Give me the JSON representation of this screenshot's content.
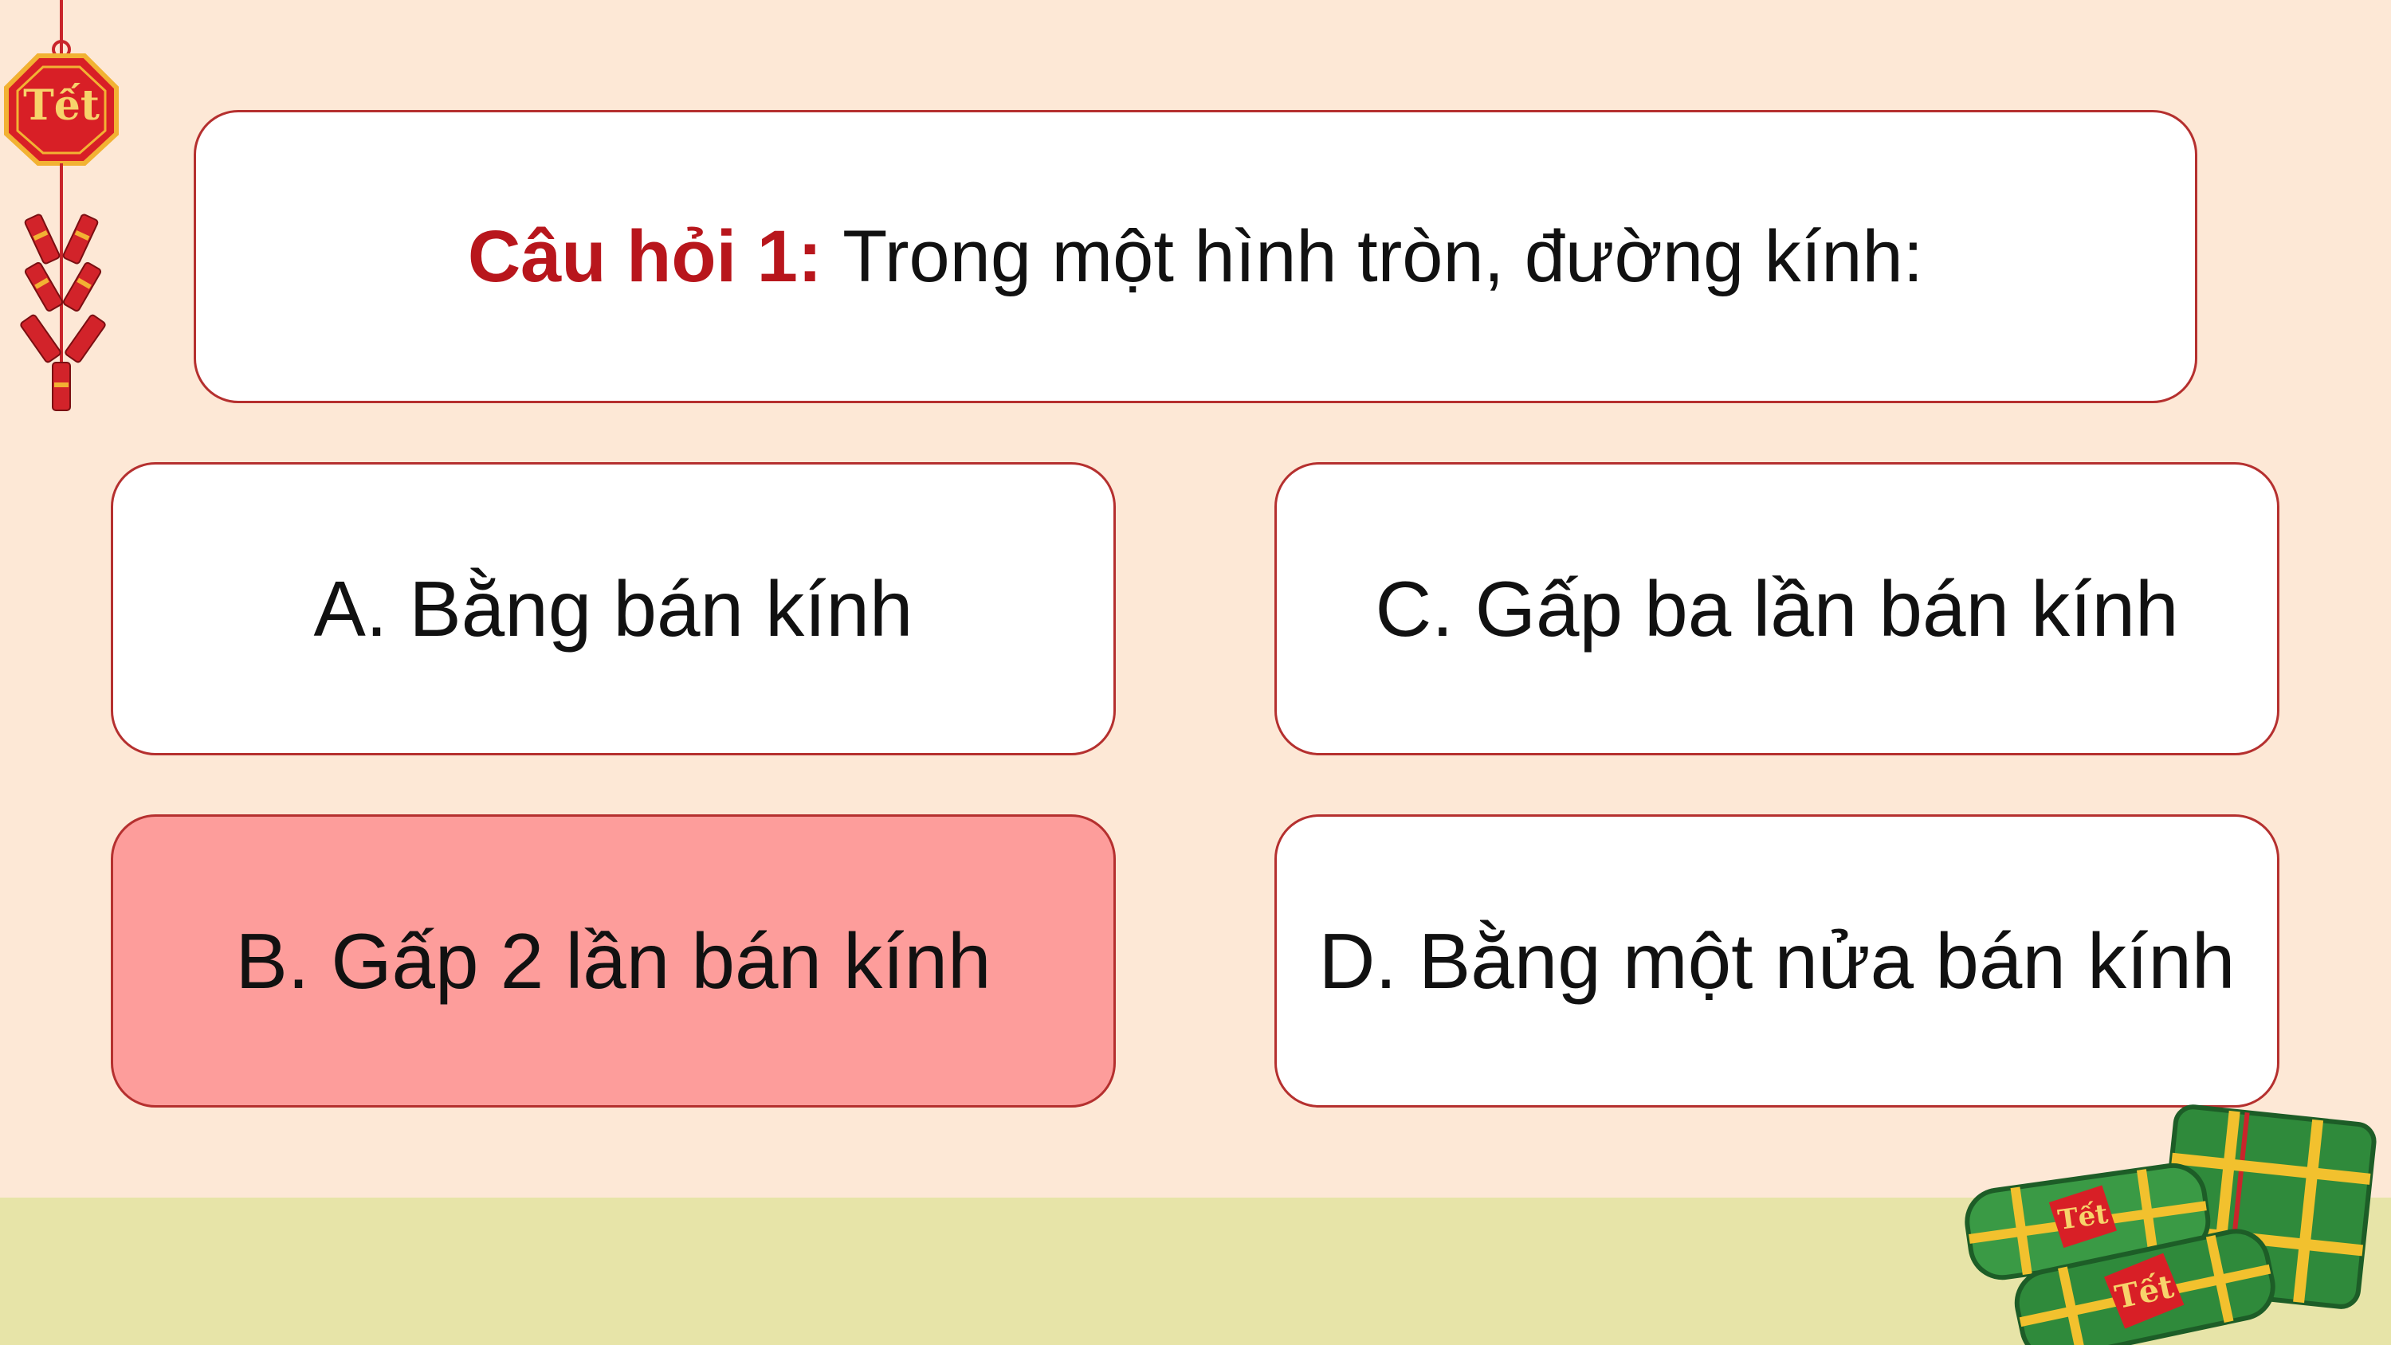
{
  "question": {
    "label": "Câu hỏi 1: ",
    "text": "Trong một hình tròn, đường kính:"
  },
  "answers": [
    {
      "text": "A. Bằng bán kính",
      "selected": false
    },
    {
      "text": "C. Gấp ba lần bán kính",
      "selected": false
    },
    {
      "text": "B. Gấp 2 lần bán kính",
      "selected": true
    },
    {
      "text": "D. Bằng một nửa bán kính",
      "selected": false
    }
  ],
  "decorations": {
    "lantern_text": "Tết",
    "cake_label_1": "Tết",
    "cake_label_2": "Tết"
  },
  "colors": {
    "background": "#fde8d6",
    "ground": "#e7e4a8",
    "accent_red": "#b8161c",
    "correct_answer": "#fd9d9b",
    "border": "#b5302f"
  }
}
